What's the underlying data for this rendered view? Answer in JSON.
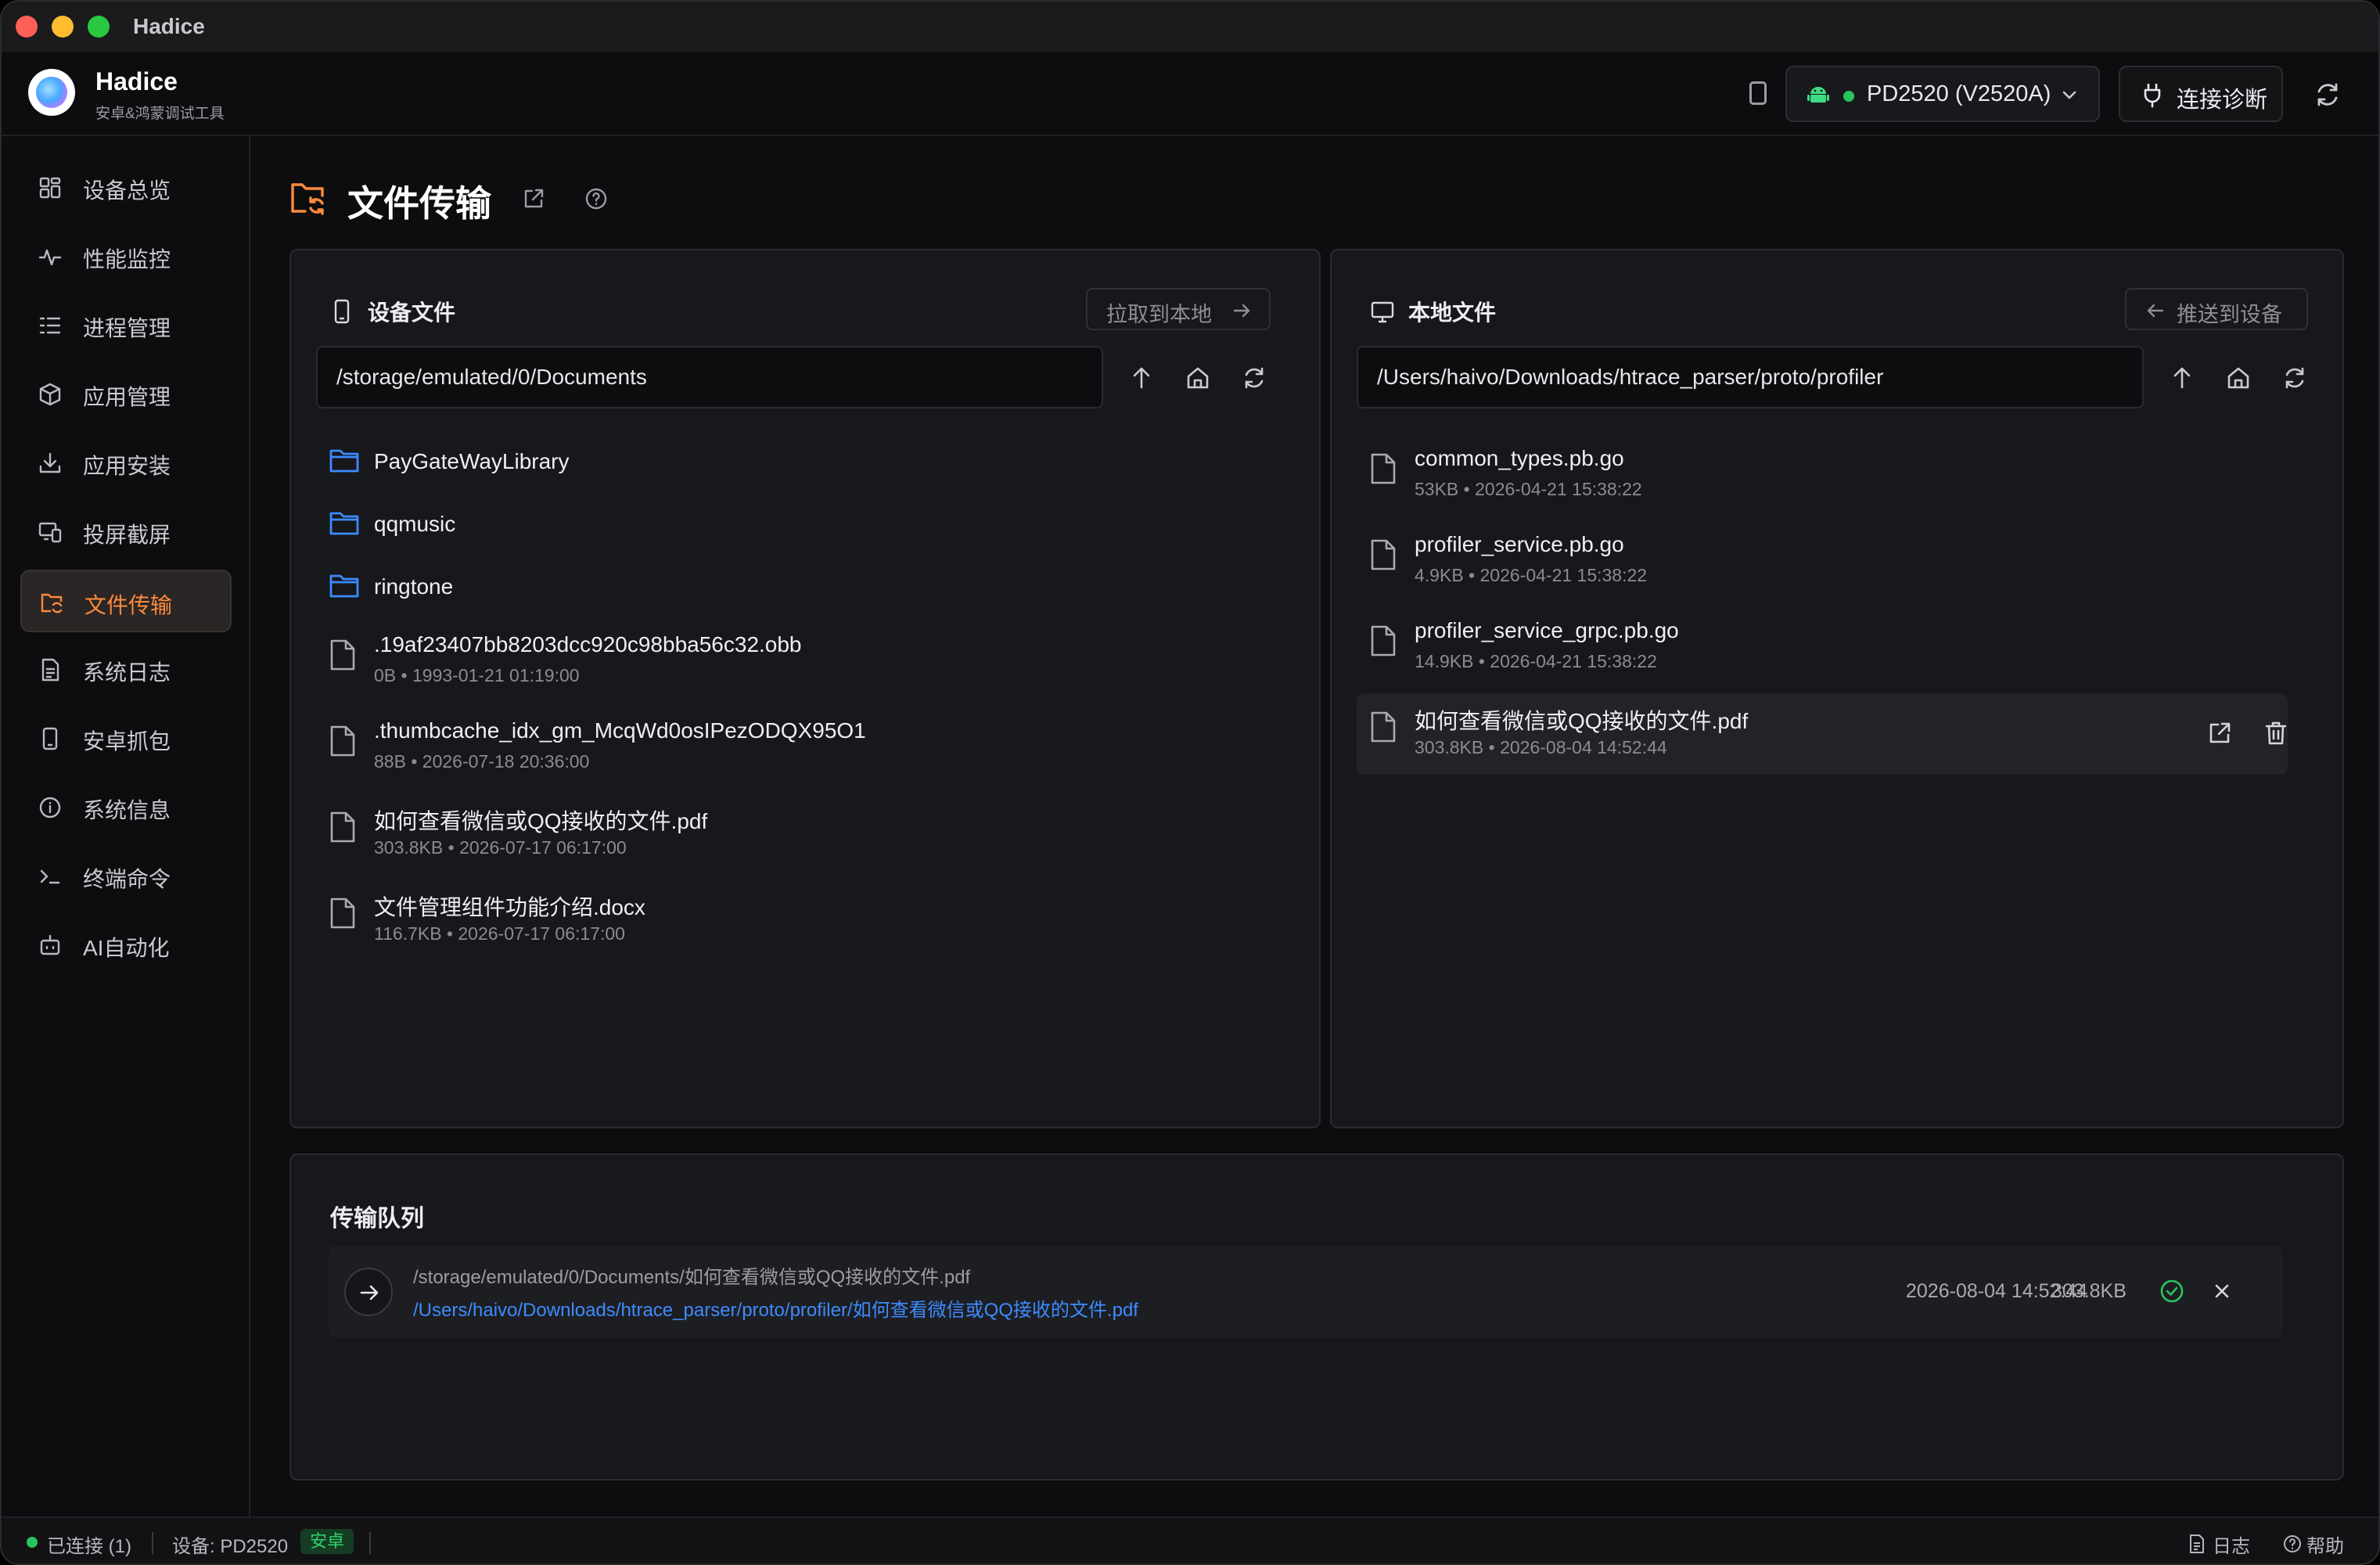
{
  "window": {
    "title": "Hadice"
  },
  "app": {
    "name": "Hadice",
    "subtitle": "安卓&鸿蒙调试工具"
  },
  "header": {
    "device_label": "PD2520 (V2520A)",
    "device_status_color": "#27c45b",
    "diagnose_label": "连接诊断"
  },
  "sidebar": {
    "items": [
      {
        "label": "设备总览",
        "icon": "grid-icon"
      },
      {
        "label": "性能监控",
        "icon": "pulse-icon"
      },
      {
        "label": "进程管理",
        "icon": "list-icon"
      },
      {
        "label": "应用管理",
        "icon": "package-icon"
      },
      {
        "label": "应用安装",
        "icon": "download-icon"
      },
      {
        "label": "投屏截屏",
        "icon": "screen-cast-icon"
      },
      {
        "label": "文件传输",
        "icon": "folder-sync-icon",
        "active": true
      },
      {
        "label": "系统日志",
        "icon": "document-icon"
      },
      {
        "label": "安卓抓包",
        "icon": "phone-icon"
      },
      {
        "label": "系统信息",
        "icon": "info-icon"
      },
      {
        "label": "终端命令",
        "icon": "terminal-icon"
      },
      {
        "label": "AI自动化",
        "icon": "robot-icon"
      }
    ]
  },
  "page": {
    "title": "文件传输",
    "accent": "#ff8a3d"
  },
  "device_panel": {
    "title": "设备文件",
    "action_label": "拉取到本地",
    "path": "/storage/emulated/0/Documents",
    "items": [
      {
        "type": "folder",
        "name": "PayGateWayLibrary"
      },
      {
        "type": "folder",
        "name": "qqmusic"
      },
      {
        "type": "folder",
        "name": "ringtone"
      },
      {
        "type": "file",
        "name": ".19af23407bb8203dcc920c98bba56c32.obb",
        "size": "0B",
        "date": "1993-01-21 01:19:00"
      },
      {
        "type": "file",
        "name": ".thumbcache_idx_gm_McqWd0osIPezODQX95O1",
        "size": "88B",
        "date": "2026-07-18 20:36:00"
      },
      {
        "type": "file",
        "name": "如何查看微信或QQ接收的文件.pdf",
        "size": "303.8KB",
        "date": "2026-07-17 06:17:00"
      },
      {
        "type": "file",
        "name": "文件管理组件功能介绍.docx",
        "size": "116.7KB",
        "date": "2026-07-17 06:17:00"
      }
    ]
  },
  "local_panel": {
    "title": "本地文件",
    "action_label": "推送到设备",
    "path": "/Users/haivo/Downloads/htrace_parser/proto/profiler",
    "items": [
      {
        "type": "file",
        "name": "common_types.pb.go",
        "size": "53KB",
        "date": "2026-04-21 15:38:22"
      },
      {
        "type": "file",
        "name": "profiler_service.pb.go",
        "size": "4.9KB",
        "date": "2026-04-21 15:38:22"
      },
      {
        "type": "file",
        "name": "profiler_service_grpc.pb.go",
        "size": "14.9KB",
        "date": "2026-04-21 15:38:22"
      },
      {
        "type": "file",
        "name": "如何查看微信或QQ接收的文件.pdf",
        "size": "303.8KB",
        "date": "2026-08-04 14:52:44",
        "hover": true
      }
    ]
  },
  "queue": {
    "title": "传输队列",
    "items": [
      {
        "src": "/storage/emulated/0/Documents/如何查看微信或QQ接收的文件.pdf",
        "dst": "/Users/haivo/Downloads/htrace_parser/proto/profiler/如何查看微信或QQ接收的文件.pdf",
        "time": "2026-08-04 14:52:44",
        "size": "303.8KB",
        "status": "done"
      }
    ]
  },
  "status_bar": {
    "connection": "已连接 (1)",
    "device": "设备: PD2520",
    "platform_badge": "安卓",
    "log_label": "日志",
    "help_label": "帮助"
  }
}
